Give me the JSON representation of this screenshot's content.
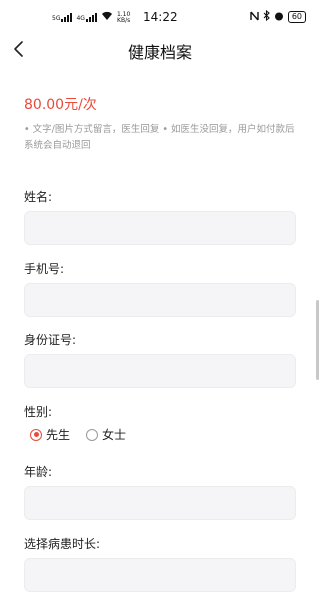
{
  "status_bar": {
    "signal1": "5G",
    "signal2": "4G",
    "speed": "1.10",
    "speed_unit": "KB/s",
    "time": "14:22",
    "battery": "60"
  },
  "header": {
    "title": "健康档案"
  },
  "price": "80.00元/次",
  "note": "• 文字/图片方式留言，医生回复 • 如医生没回复，用户如付款后系统会自动退回",
  "form": {
    "name_label": "姓名:",
    "phone_label": "手机号:",
    "id_label": "身份证号:",
    "gender_label": "性别:",
    "gender_options": [
      "先生",
      "女士"
    ],
    "gender_selected": "先生",
    "age_label": "年龄:",
    "duration_label": "选择病患时长:"
  },
  "colors": {
    "accent": "#e84a3c",
    "field_bg": "#f5f5f7",
    "note": "#999999"
  },
  "icons": [
    "back-arrow-icon",
    "wifi-icon",
    "nfc-icon",
    "bluetooth-icon",
    "alarm-icon",
    "battery-icon"
  ]
}
